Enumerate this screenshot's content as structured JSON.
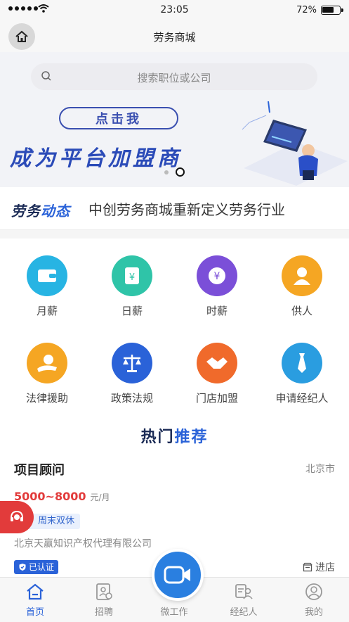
{
  "status_bar": {
    "time": "23:05",
    "battery": "72%",
    "battery_level": 0.72
  },
  "nav": {
    "title": "劳务商城"
  },
  "search": {
    "placeholder": "搜索职位或公司"
  },
  "banner": {
    "button_label": "点击我",
    "headline": "成为平台加盟商",
    "page_count": 2,
    "active_page": 2
  },
  "news": {
    "logo_part1": "劳务",
    "logo_part2": "动态",
    "headline": "中创劳务商城重新定义劳务行业"
  },
  "categories": [
    {
      "label": "月薪",
      "icon": "wallet-icon",
      "color": "#27b4e3"
    },
    {
      "label": "日薪",
      "icon": "calendar-icon",
      "color": "#2fc4a8"
    },
    {
      "label": "时薪",
      "icon": "yen-coin-icon",
      "color": "#7b4fd8"
    },
    {
      "label": "供人",
      "icon": "person-icon",
      "color": "#f5a623"
    },
    {
      "label": "法律援助",
      "icon": "hand-coin-icon",
      "color": "#f5a623"
    },
    {
      "label": "政策法规",
      "icon": "scales-icon",
      "color": "#2a62d8"
    },
    {
      "label": "门店加盟",
      "icon": "handshake-icon",
      "color": "#f06a2b"
    },
    {
      "label": "申请经纪人",
      "icon": "tie-icon",
      "color": "#2a9de0"
    }
  ],
  "hot": {
    "title_part1": "热门",
    "title_part2": "推荐"
  },
  "job": {
    "title": "项目顾问",
    "city": "北京市",
    "salary": "5000~8000",
    "salary_unit": "元/月",
    "tag": "资，周末双休",
    "company": "北京天赢知识产权代理有限公司",
    "verified": "已认证",
    "enter_store": "进店"
  },
  "tabs": [
    {
      "label": "首页",
      "icon": "home-icon",
      "active": true
    },
    {
      "label": "招聘",
      "icon": "recruit-icon",
      "active": false
    },
    {
      "label": "微工作",
      "icon": "video-camera-icon",
      "active": false
    },
    {
      "label": "经纪人",
      "icon": "agent-icon",
      "active": false
    },
    {
      "label": "我的",
      "icon": "profile-icon",
      "active": false
    }
  ],
  "colors": {
    "brand_blue": "#2a62d8",
    "salary_red": "#e23b3b"
  }
}
